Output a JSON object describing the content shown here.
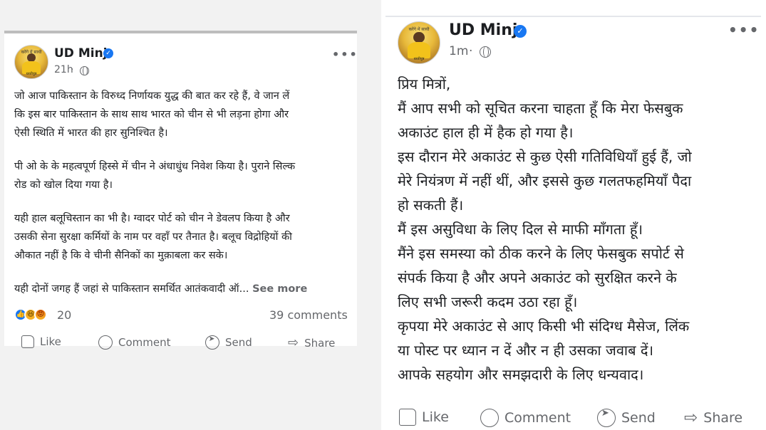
{
  "left_post": {
    "author": "UD Minj",
    "time": "21h",
    "avatar_text_top": "करेंगे में साथी",
    "avatar_text_bottom": "धरतीपुत्र",
    "lines": [
      "जो आज पाकिस्तान के विरुध्द निर्णायक युद्ध की बात कर रहे हैं, वे जान लें",
      "कि इस बार पाकिस्तान के साथ साथ भारत को चीन से भी लड़ना होगा और",
      "ऐसी स्थिति में भारत की हार सुनिश्चित है।",
      "पी ओ के के महत्वपूर्ण हिस्से में चीन ने अंधाधुंध निवेश किया है। पुराने सिल्क",
      "रोड को खोल दिया गया है।",
      "यही हाल बलूचिस्तान का भी है। ग्वादर पोर्ट को चीन ने डेवलप किया है और",
      "उसकी सेना सुरक्षा कर्मियों के नाम पर वहाँ पर तैनात है। बलूच विद्रोहियों की",
      "औकात नहीं है कि वे चीनी सैनिकों का मुक़ाबला कर सके।",
      "यही दोनों जगह हैं जहां से पाकिस्तान समर्थित आतंकवादी ऑ..."
    ],
    "see_more": "See more",
    "reaction_count": "20",
    "comments": "39 comments",
    "actions": {
      "like": "Like",
      "comment": "Comment",
      "send": "Send",
      "share": "Share"
    }
  },
  "right_post": {
    "author": "UD Minj",
    "time": "1m",
    "avatar_text_top": "करेंगे में साथी",
    "avatar_text_bottom": "धरतीपुत्र",
    "lines": [
      "प्रिय मित्रों,",
      "मैं आप सभी को सूचित करना चाहता हूँ कि मेरा फेसबुक",
      "अकाउंट हाल ही में हैक हो गया है।",
      " इस दौरान मेरे अकाउंट से कुछ ऐसी गतिविधियाँ हुई हैं, जो",
      "मेरे नियंत्रण में नहीं थीं, और इससे कुछ गलतफहमियाँ पैदा",
      "हो सकती हैं।",
      "   मैं इस असुविधा के लिए दिल से माफी माँगता हूँ।",
      "मैंने इस समस्या को ठीक करने के लिए फेसबुक सपोर्ट से",
      "संपर्क किया है और अपने अकाउंट को सुरक्षित करने के",
      "लिए सभी जरूरी कदम उठा रहा हूँ।",
      "कृपया मेरे अकाउंट से आए किसी भी संदिग्ध मैसेज, लिंक",
      "या पोस्ट पर ध्यान न दें और न ही उसका जवाब दें।",
      "आपके सहयोग और समझदारी के लिए धन्यवाद।"
    ],
    "actions": {
      "like": "Like",
      "comment": "Comment",
      "send": "Send",
      "share": "Share"
    }
  },
  "colors": {
    "accent": "#1877f2",
    "muted": "#65676b",
    "text": "#1c1e21"
  }
}
